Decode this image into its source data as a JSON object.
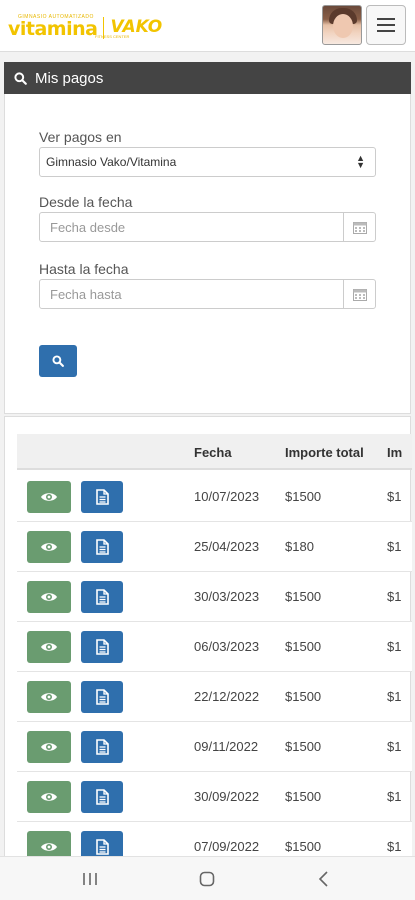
{
  "header": {
    "logo_small_text": "GIMNASIO AUTOMATIZADO",
    "logo_vitamina": "vitamina",
    "logo_vako": "VAKO",
    "logo_vako_sub": "FITNESS CENTER"
  },
  "section": {
    "title": "Mis pagos"
  },
  "filters": {
    "gym_label": "Ver pagos en",
    "gym_value": "Gimnasio Vako/Vitamina",
    "from_label": "Desde la fecha",
    "from_placeholder": "Fecha desde",
    "to_label": "Hasta la fecha",
    "to_placeholder": "Fecha hasta"
  },
  "table": {
    "headers": [
      "Fecha",
      "Importe total",
      "Im"
    ],
    "rows": [
      {
        "fecha": "10/07/2023",
        "importe": "$1500",
        "extra": "$1"
      },
      {
        "fecha": "25/04/2023",
        "importe": "$180",
        "extra": "$1"
      },
      {
        "fecha": "30/03/2023",
        "importe": "$1500",
        "extra": "$1"
      },
      {
        "fecha": "06/03/2023",
        "importe": "$1500",
        "extra": "$1"
      },
      {
        "fecha": "22/12/2022",
        "importe": "$1500",
        "extra": "$1"
      },
      {
        "fecha": "09/11/2022",
        "importe": "$1500",
        "extra": "$1"
      },
      {
        "fecha": "30/09/2022",
        "importe": "$1500",
        "extra": "$1"
      },
      {
        "fecha": "07/09/2022",
        "importe": "$1500",
        "extra": "$1"
      }
    ]
  },
  "colors": {
    "brand_yellow": "#f2c400",
    "header_dark": "#444444",
    "view_button": "#6a9c70",
    "doc_button": "#2f6fad"
  },
  "icons": {
    "search": "search-icon",
    "calendar": "calendar-icon",
    "view": "eye-icon",
    "document": "document-icon",
    "menu": "hamburger-menu-icon"
  }
}
